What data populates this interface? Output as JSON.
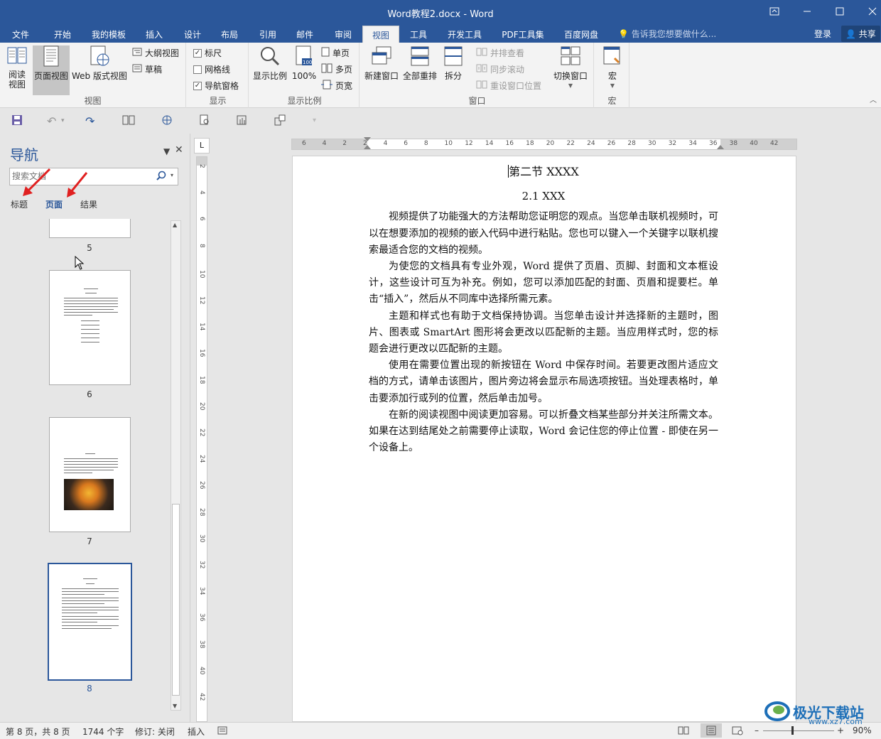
{
  "window": {
    "title": "Word教程2.docx - Word",
    "controls": [
      "ribbon-display-icon",
      "minimize-icon",
      "maximize-icon",
      "close-icon"
    ]
  },
  "tabs": [
    {
      "label": "文件"
    },
    {
      "label": "开始"
    },
    {
      "label": "我的模板"
    },
    {
      "label": "插入"
    },
    {
      "label": "设计"
    },
    {
      "label": "布局"
    },
    {
      "label": "引用"
    },
    {
      "label": "邮件"
    },
    {
      "label": "审阅"
    },
    {
      "label": "视图",
      "active": true
    },
    {
      "label": "工具"
    },
    {
      "label": "开发工具"
    },
    {
      "label": "PDF工具集"
    },
    {
      "label": "百度网盘"
    }
  ],
  "tell_me": "告诉我您想要做什么...",
  "login": "登录",
  "share": "共享",
  "ribbon": {
    "views": {
      "label": "视图",
      "read_mode": "阅读\n视图",
      "print_layout": "页面视图",
      "web_layout": "Web 版式视图",
      "outline": "大纲视图",
      "draft": "草稿"
    },
    "show": {
      "label": "显示",
      "ruler": "标尺",
      "ruler_checked": true,
      "gridlines": "网格线",
      "gridlines_checked": false,
      "navpane": "导航窗格",
      "navpane_checked": true
    },
    "zoom": {
      "label": "显示比例",
      "zoom": "显示比例",
      "hundred": "100%",
      "one_page": "单页",
      "multi_page": "多页",
      "page_width": "页宽"
    },
    "window": {
      "label": "窗口",
      "new_window": "新建窗口",
      "arrange_all": "全部重排",
      "split": "拆分",
      "side_by_side": "并排查看",
      "sync_scroll": "同步滚动",
      "reset_position": "重设窗口位置",
      "switch_windows": "切换窗口"
    },
    "macros": {
      "label": "宏",
      "macros": "宏"
    }
  },
  "nav": {
    "title": "导航",
    "search_placeholder": "搜索文档",
    "tabs": [
      "标题",
      "页面",
      "结果"
    ],
    "active_tab": "页面",
    "pages": [
      "5",
      "6",
      "7",
      "8"
    ],
    "selected_page": "8"
  },
  "ruler": {
    "h_ticks": [
      "6",
      "4",
      "2",
      "2",
      "4",
      "6",
      "8",
      "10",
      "12",
      "14",
      "16",
      "18",
      "20",
      "22",
      "24",
      "26",
      "28",
      "30",
      "32",
      "34",
      "36",
      "38",
      "40",
      "42"
    ],
    "v_ticks": [
      "2",
      "4",
      "6",
      "8",
      "10",
      "12",
      "14",
      "16",
      "18",
      "20",
      "22",
      "24",
      "26",
      "28",
      "30",
      "32",
      "34",
      "36",
      "38",
      "40",
      "42"
    ]
  },
  "document": {
    "heading1": "第二节  XXXX",
    "heading2": "2.1 XXX",
    "paragraphs": [
      "视频提供了功能强大的方法帮助您证明您的观点。当您单击联机视频时，可以在想要添加的视频的嵌入代码中进行粘贴。您也可以键入一个关键字以联机搜索最适合您的文档的视频。",
      "为使您的文档具有专业外观，Word 提供了页眉、页脚、封面和文本框设计，这些设计可互为补充。例如，您可以添加匹配的封面、页眉和提要栏。单击“插入”，然后从不同库中选择所需元素。",
      "主题和样式也有助于文档保持协调。当您单击设计并选择新的主题时，图片、图表或 SmartArt 图形将会更改以匹配新的主题。当应用样式时，您的标题会进行更改以匹配新的主题。",
      "使用在需要位置出现的新按钮在 Word 中保存时间。若要更改图片适应文档的方式，请单击该图片，图片旁边将会显示布局选项按钮。当处理表格时，单击要添加行或列的位置，然后单击加号。",
      "在新的阅读视图中阅读更加容易。可以折叠文档某些部分并关注所需文本。如果在达到结尾处之前需要停止读取，Word 会记住您的停止位置 - 即使在另一个设备上。"
    ]
  },
  "status": {
    "page": "第 8 页，共 8 页",
    "words": "1744 个字",
    "track": "修订: 关闭",
    "mode": "插入",
    "zoom": "90%"
  },
  "watermark": {
    "brand": "极光下载站",
    "url": "www.xz7.com"
  },
  "colors": {
    "accent": "#2b579a",
    "annotation_arrow": "#e02020"
  }
}
